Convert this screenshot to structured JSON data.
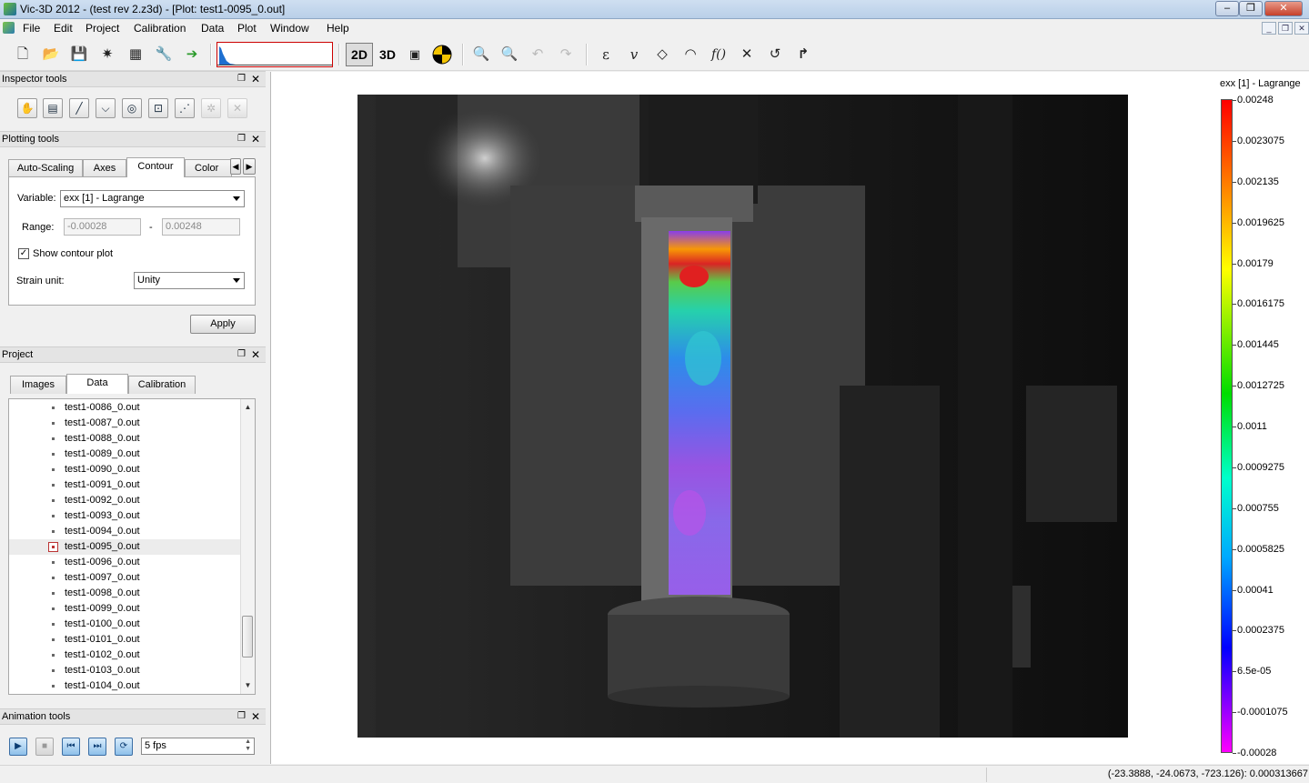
{
  "window": {
    "title": "Vic-3D 2012 - (test rev 2.z3d) - [Plot: test1-0095_0.out]"
  },
  "menubar": {
    "items": [
      "File",
      "Edit",
      "Project",
      "Calibration",
      "Data",
      "Plot",
      "Window",
      "Help"
    ]
  },
  "toolbar": {
    "btn_2d": "2D",
    "btn_3d": "3D",
    "function_label": "f()",
    "epsilon_label": "ε",
    "nu_label": "v"
  },
  "inspector_tools": {
    "title": "Inspector tools"
  },
  "plotting_tools": {
    "title": "Plotting tools",
    "tabs": [
      "Auto-Scaling",
      "Axes",
      "Contour",
      "Color ma"
    ],
    "active_tab": "Contour",
    "variable_label": "Variable:",
    "variable_value": "exx [1] - Lagrange",
    "range_label": "Range:",
    "range_min": "-0.00028",
    "range_sep": "-",
    "range_max": "0.00248",
    "show_contour_label": "Show contour plot",
    "show_contour_checked": true,
    "strain_unit_label": "Strain unit:",
    "strain_unit_value": "Unity",
    "apply_label": "Apply"
  },
  "project": {
    "title": "Project",
    "tabs": [
      "Images",
      "Data",
      "Calibration"
    ],
    "active_tab": "Data",
    "files": [
      "test1-0086_0.out",
      "test1-0087_0.out",
      "test1-0088_0.out",
      "test1-0089_0.out",
      "test1-0090_0.out",
      "test1-0091_0.out",
      "test1-0092_0.out",
      "test1-0093_0.out",
      "test1-0094_0.out",
      "test1-0095_0.out",
      "test1-0096_0.out",
      "test1-0097_0.out",
      "test1-0098_0.out",
      "test1-0099_0.out",
      "test1-0100_0.out",
      "test1-0101_0.out",
      "test1-0102_0.out",
      "test1-0103_0.out",
      "test1-0104_0.out"
    ],
    "selected_file": "test1-0095_0.out"
  },
  "animation_tools": {
    "title": "Animation tools",
    "fps_value": "5 fps"
  },
  "colorbar": {
    "title": "exx [1] - Lagrange",
    "labels": [
      "0.00248",
      "0.0023075",
      "0.002135",
      "0.0019625",
      "0.00179",
      "0.0016175",
      "0.001445",
      "0.0012725",
      "0.0011",
      "0.0009275",
      "0.000755",
      "0.0005825",
      "0.00041",
      "0.0002375",
      "6.5e-05",
      "-0.0001075",
      "-0.00028"
    ],
    "colors": [
      "#ff0000",
      "#ff8800",
      "#ffff00",
      "#00dd00",
      "#00ffcc",
      "#00aaff",
      "#0000ff",
      "#ff00ff"
    ]
  },
  "statusbar": {
    "coords": "(-23.3888, -24.0673, -723.126): 0.000313667"
  }
}
